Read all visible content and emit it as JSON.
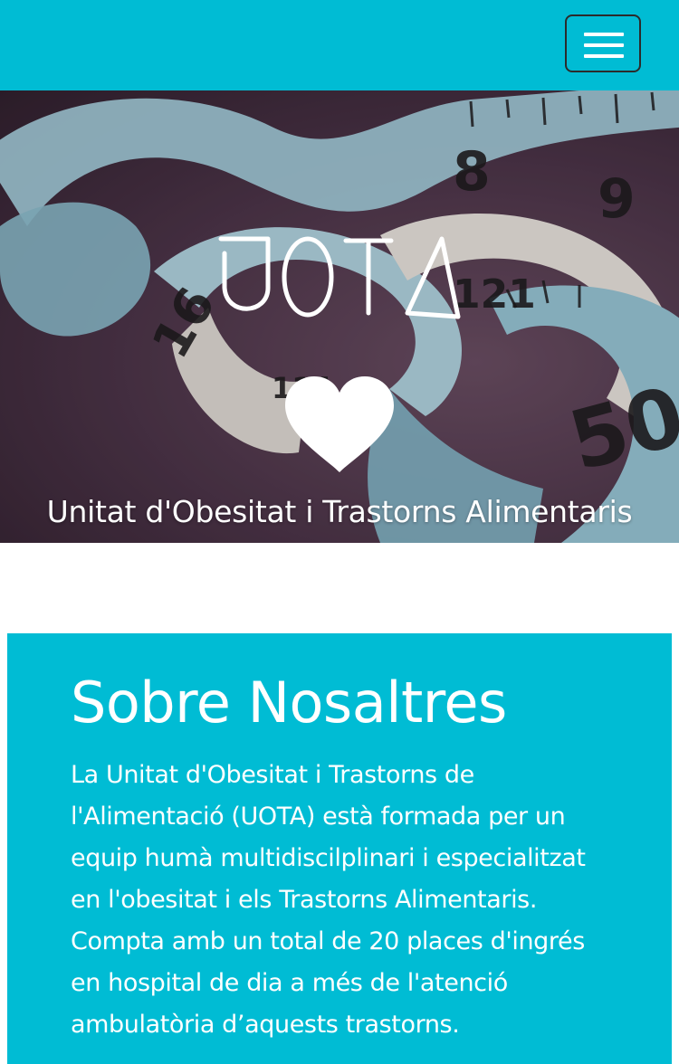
{
  "navbar": {
    "menu_icon": "hamburger-menu-icon",
    "background_color": "#00bcd4"
  },
  "hero": {
    "logo_text": "UOTA",
    "heart_icon": "heart-icon",
    "tagline": "Unitat d'Obesitat i Trastorns Alimentaris"
  },
  "about": {
    "title": "Sobre Nosaltres",
    "body": "La Unitat d'Obesitat i Trastorns de l'Alimentació (UOTA) està formada per un equip humà multidiscilplinari i especialitzat en l'obesitat i els Trastorns Alimentaris. Compta amb un total de 20 places d'ingrés en hospital de dia a més de l'atenció ambulatòria d’aquests trastorns.",
    "background_color": "#00bcd4"
  }
}
